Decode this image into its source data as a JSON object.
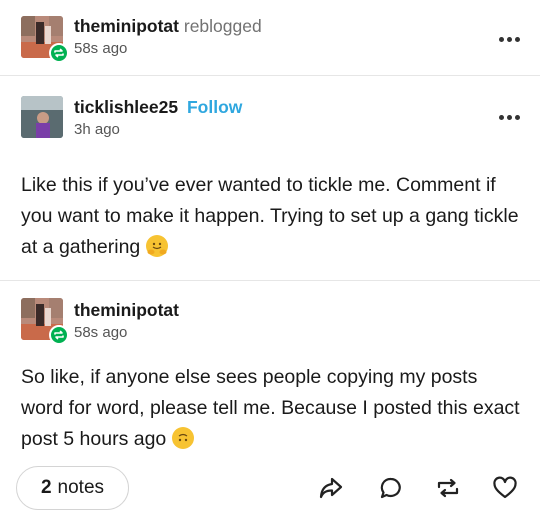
{
  "reblog_header": {
    "username": "theminipotat",
    "action": "reblogged",
    "time": "58s ago"
  },
  "original_post": {
    "username": "ticklishlee25",
    "follow_label": "Follow",
    "time": "3h ago",
    "text": "Like this if you’ve ever wanted to tickle me. Comment if you want to make it happen. Trying to set up a gang tickle at a gathering",
    "emoji": "hugging-face-emoji"
  },
  "reblog_comment": {
    "username": "theminipotat",
    "time": "58s ago",
    "text": "So like, if anyone else sees people copying my posts word for word, please tell me. Because I posted this exact post 5 hours ago",
    "emoji": "upside-down-face-emoji"
  },
  "footer": {
    "notes_count": "2",
    "notes_word": "notes",
    "actions": [
      "share-icon",
      "reply-icon",
      "reblog-icon",
      "like-icon"
    ]
  },
  "colors": {
    "follow": "#2fa7df",
    "reblog_badge": "#00b152",
    "divider": "#e6e6e6",
    "text": "#1a1a1a",
    "muted": "#555555"
  }
}
